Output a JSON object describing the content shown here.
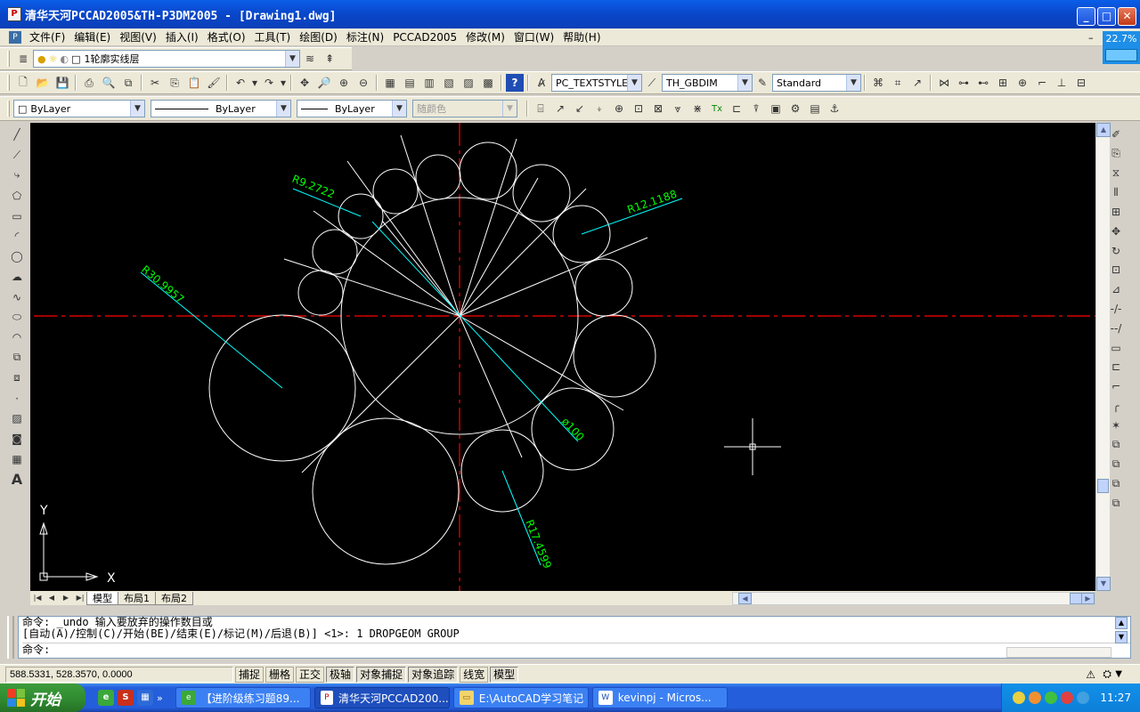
{
  "window": {
    "title": "清华天河PCCAD2005&TH-P3DM2005 - [Drawing1.dwg]",
    "min": "_",
    "max": "□",
    "close": "✕"
  },
  "menu": [
    "文件(F)",
    "编辑(E)",
    "视图(V)",
    "插入(I)",
    "格式(O)",
    "工具(T)",
    "绘图(D)",
    "标注(N)",
    "PCCAD2005",
    "修改(M)",
    "窗口(W)",
    "帮助(H)"
  ],
  "zoom": "22.7%",
  "layer": {
    "name": "1轮廓实线层"
  },
  "styles": {
    "text": "PC_TEXTSTYLE",
    "dim": "TH_GBDIM",
    "table": "Standard"
  },
  "properties": {
    "color": "ByLayer",
    "linetype": "ByLayer",
    "lineweight": "ByLayer",
    "plotstyle": "随颜色"
  },
  "drawing": {
    "dims": [
      "R9.2722",
      "R12.1188",
      "R30.9957",
      "ø100",
      "R17.4599"
    ],
    "ucs": {
      "x": "X",
      "y": "Y"
    },
    "colors": {
      "bg": "#000000",
      "geom": "#ffffff",
      "center": "#ff0000",
      "dim_line": "#00ffff",
      "dim_text": "#00ff00"
    }
  },
  "layout_tabs": [
    "模型",
    "布局1",
    "布局2"
  ],
  "command": {
    "line1": "命令: _undo 输入要放弃的操作数目或",
    "line2": "[自动(A)/控制(C)/开始(BE)/结束(E)/标记(M)/后退(B)] <1>: 1 DROPGEOM GROUP",
    "prompt": "命令:"
  },
  "status": {
    "coords": "588.5331, 528.3570, 0.0000",
    "buttons": [
      "捕捉",
      "栅格",
      "正交",
      "极轴",
      "对象捕捉",
      "对象追踪",
      "线宽",
      "模型"
    ]
  },
  "taskbar": {
    "start": "开始",
    "tasks": [
      "【进阶级练习题89...",
      "清华天河PCCAD200...",
      "E:\\AutoCAD学习笔记",
      "kevinpj - Micros..."
    ],
    "clock": "11:27"
  }
}
